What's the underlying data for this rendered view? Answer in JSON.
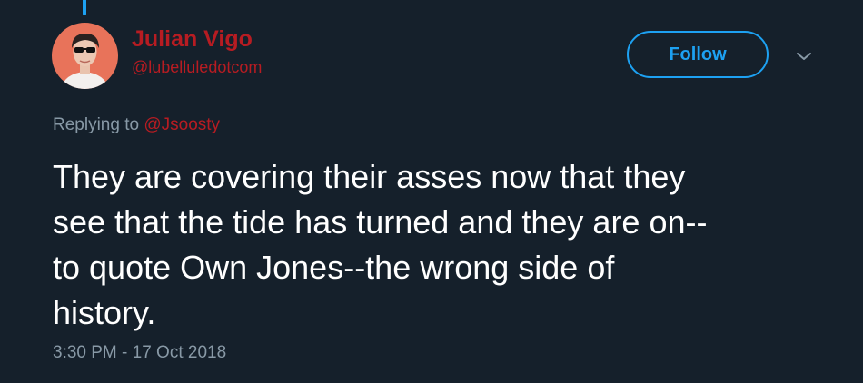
{
  "tweet": {
    "author": {
      "display_name": "Julian Vigo",
      "username": "@lubelluledotcom",
      "avatar_icon": "profile-photo-person-sunglasses"
    },
    "follow_label": "Follow",
    "menu_icon": "chevron-down-icon",
    "replying_prefix": "Replying to ",
    "replying_to": "@Jsoosty",
    "text_lines": [
      "They are covering their asses now that they",
      "see that the tide has turned and they are on--",
      "to quote Own Jones--the wrong side of",
      "history."
    ],
    "timestamp": "3:30 PM - 17 Oct 2018"
  },
  "colors": {
    "background": "#15202b",
    "accent": "#1da1f2",
    "name_color": "#b71c22",
    "muted_text": "#8899a6",
    "body_text": "#ffffff"
  }
}
